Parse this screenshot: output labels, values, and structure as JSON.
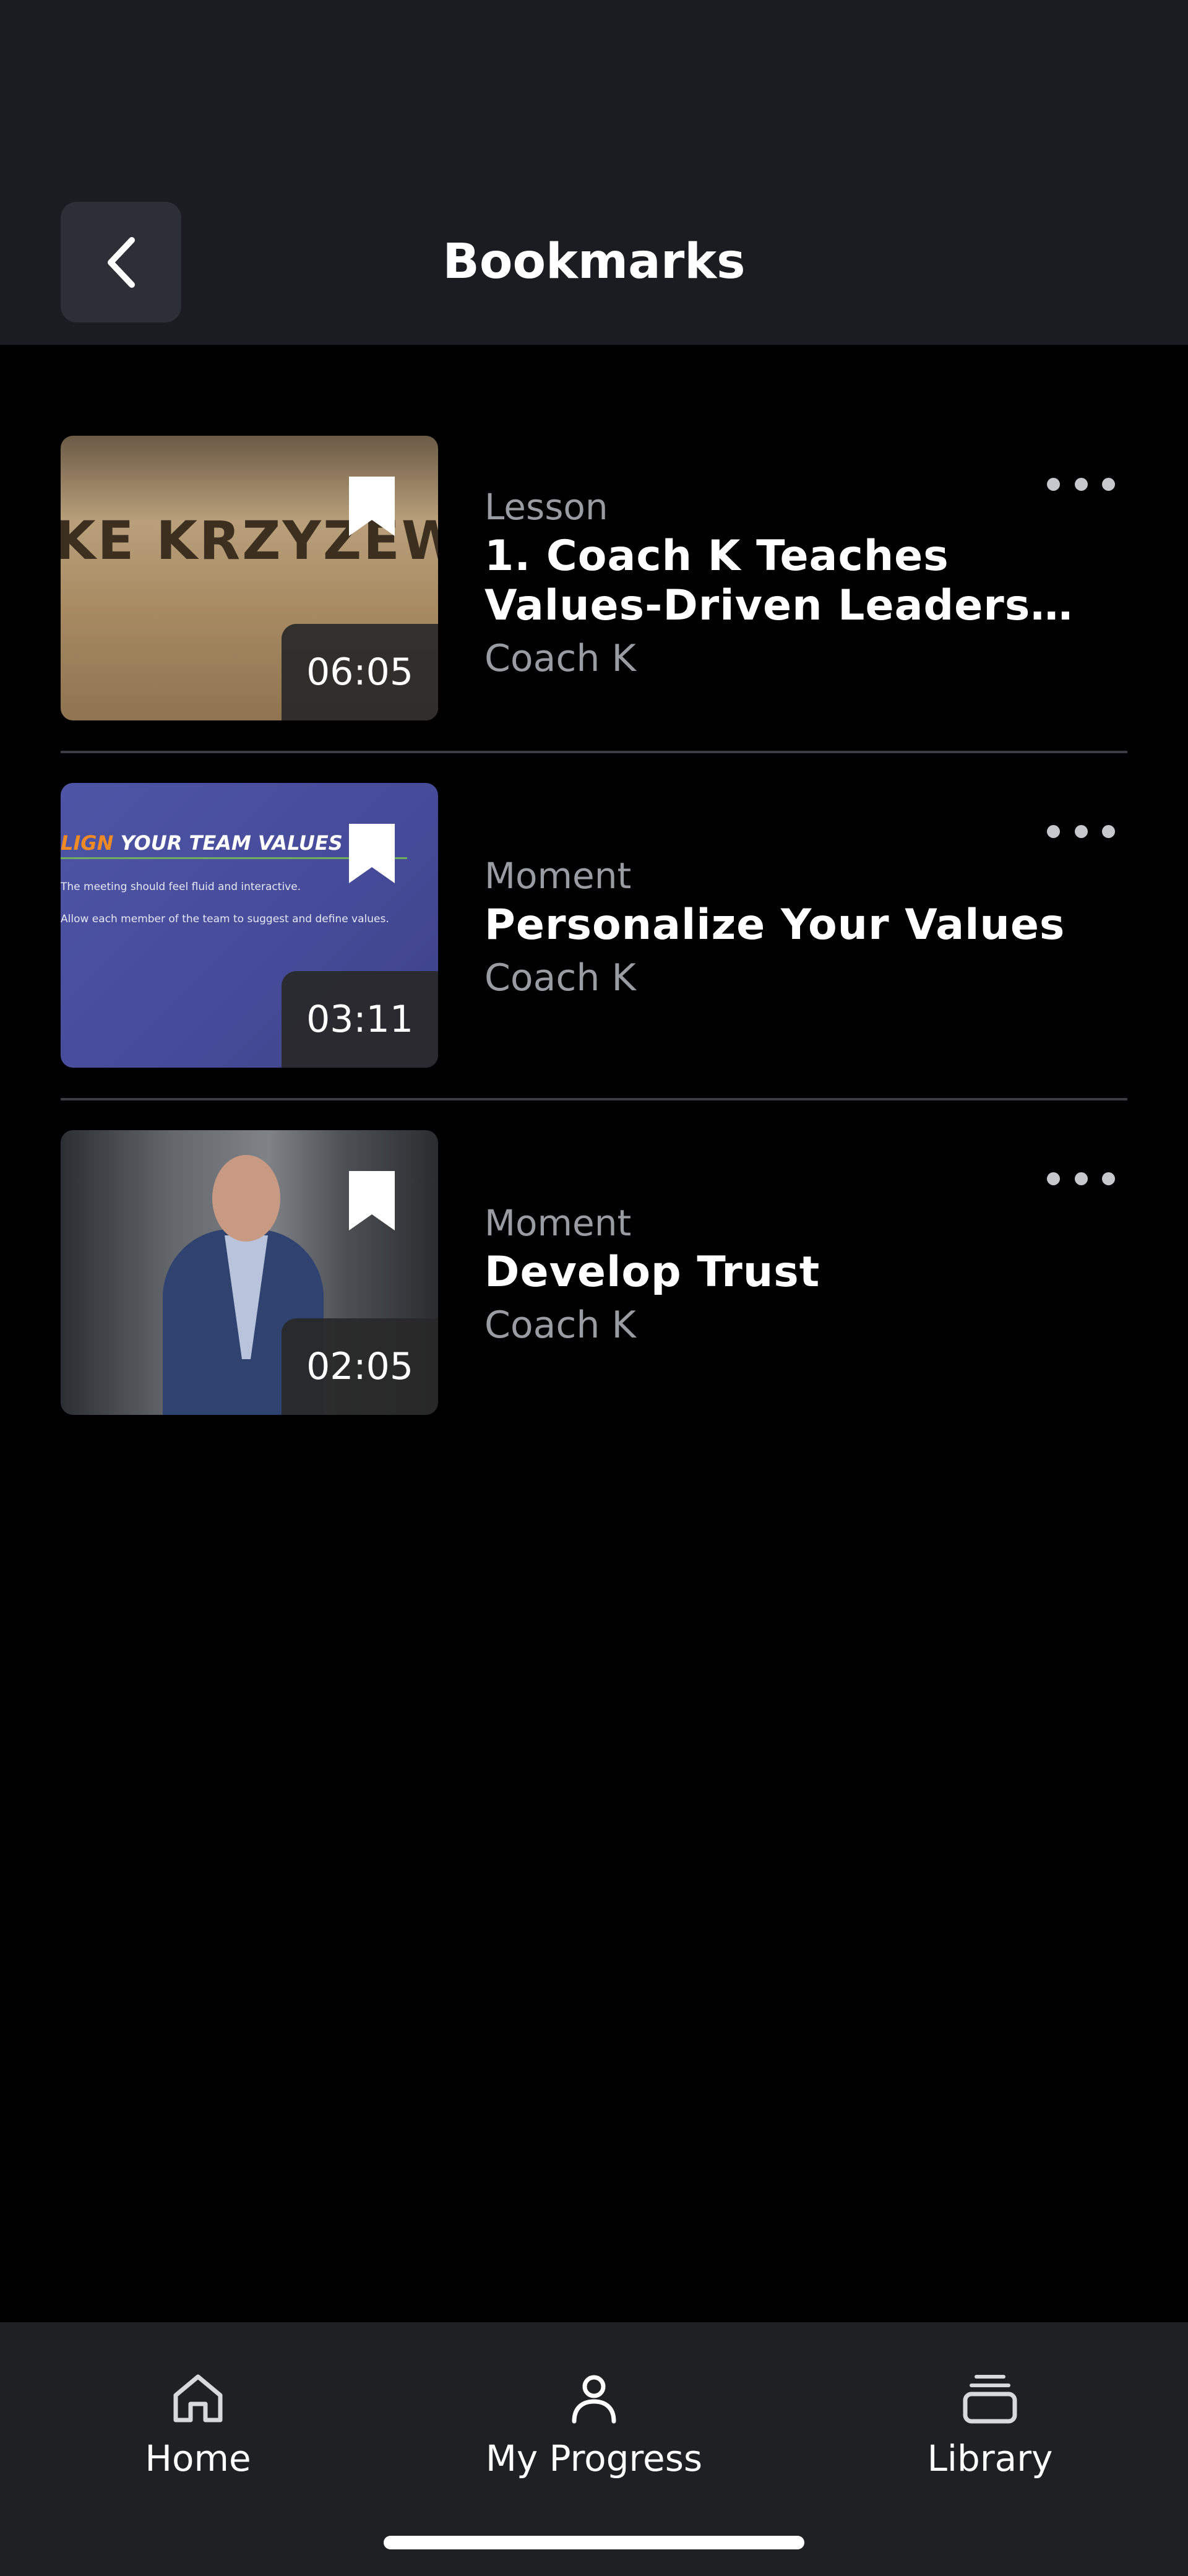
{
  "header": {
    "title": "Bookmarks",
    "back_icon": "chevron-left-icon"
  },
  "bookmarks": [
    {
      "type": "Lesson",
      "title_line1": "1. Coach K Teaches",
      "title_line2": "Values-Driven Leaders…",
      "author": "Coach K",
      "duration": "06:05",
      "thumbnail_text": "KE KRZYZEWSKI"
    },
    {
      "type": "Moment",
      "title_line1": "Personalize Your Values",
      "author": "Coach K",
      "duration": "03:11",
      "thumbnail_heading_accent": "LIGN",
      "thumbnail_heading": " YOUR TEAM VALUES",
      "thumbnail_line1": "The meeting should feel fluid and interactive.",
      "thumbnail_line2": "Allow each member of the team to suggest and define values."
    },
    {
      "type": "Moment",
      "title_line1": "Develop Trust",
      "author": "Coach K",
      "duration": "02:05"
    }
  ],
  "tabbar": {
    "home": "Home",
    "progress": "My Progress",
    "library": "Library"
  },
  "colors": {
    "header_bg": "#1a1c21",
    "background": "#000000",
    "tabbar_bg": "#1f2024",
    "secondary_text": "#9a9ca3"
  }
}
